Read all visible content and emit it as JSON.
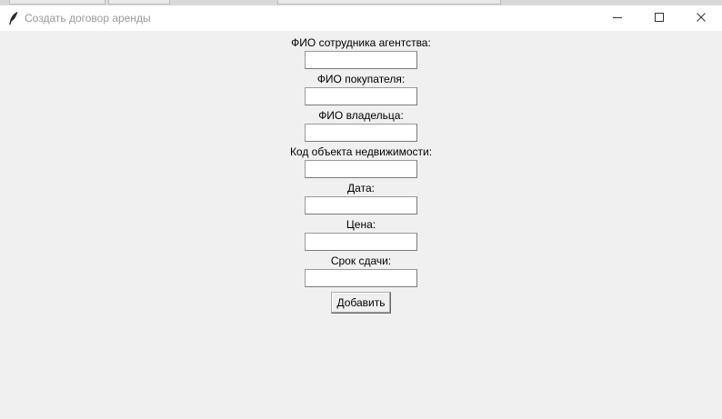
{
  "window": {
    "title": "Создать договор аренды"
  },
  "icons": {
    "app": "feather-icon",
    "minimize": "minimize-icon",
    "maximize": "maximize-icon",
    "close": "close-icon"
  },
  "form": {
    "fields": [
      {
        "label": "ФИО сотрудника агентства:",
        "value": ""
      },
      {
        "label": "ФИО покупателя:",
        "value": ""
      },
      {
        "label": "ФИО владельца:",
        "value": ""
      },
      {
        "label": "Код объекта недвижимости:",
        "value": ""
      },
      {
        "label": "Дата:",
        "value": ""
      },
      {
        "label": "Цена:",
        "value": ""
      },
      {
        "label": "Срок сдачи:",
        "value": ""
      }
    ],
    "submit_label": "Добавить"
  }
}
